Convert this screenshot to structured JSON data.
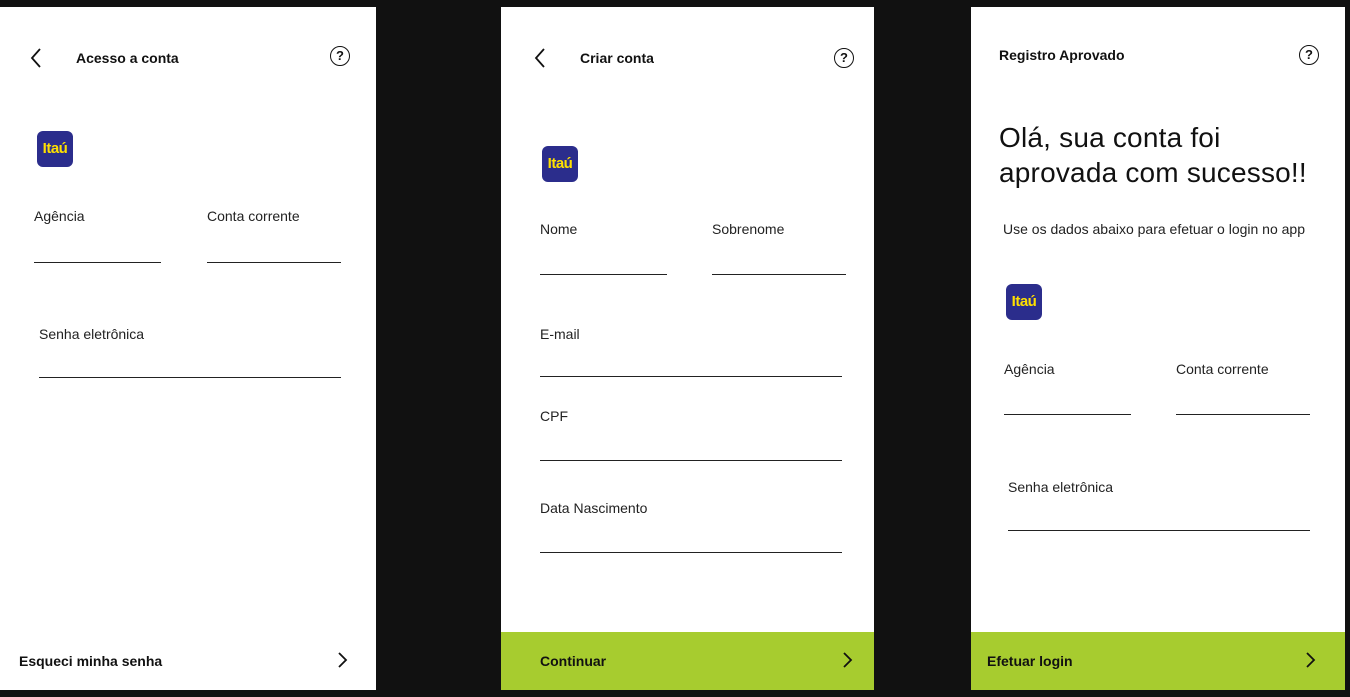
{
  "screen1": {
    "title": "Acesso a conta",
    "logo_text": "Itaú",
    "fields": {
      "agencia": "Agência",
      "conta": "Conta corrente",
      "senha": "Senha eletrônica"
    },
    "footer_label": "Esqueci minha senha"
  },
  "screen2": {
    "title": "Criar conta",
    "logo_text": "Itaú",
    "fields": {
      "nome": "Nome",
      "sobrenome": "Sobrenome",
      "email": "E-mail",
      "cpf": "CPF",
      "nascimento": "Data Nascimento"
    },
    "footer_label": "Continuar"
  },
  "screen3": {
    "title": "Registro Aprovado",
    "headline_line1": "Olá, sua conta foi",
    "headline_line2": "aprovada com sucesso!!",
    "subtitle": "Use os dados abaixo para efetuar o login no app",
    "logo_text": "Itaú",
    "fields": {
      "agencia": "Agência",
      "conta": "Conta corrente",
      "senha": "Senha eletrônica"
    },
    "footer_label": "Efetuar login"
  },
  "help_symbol": "?",
  "colors": {
    "background": "#111111",
    "screen": "#ffffff",
    "accent_green": "#a7cc2f",
    "logo_blue": "#2b2d8c",
    "logo_yellow": "#ffe000"
  }
}
